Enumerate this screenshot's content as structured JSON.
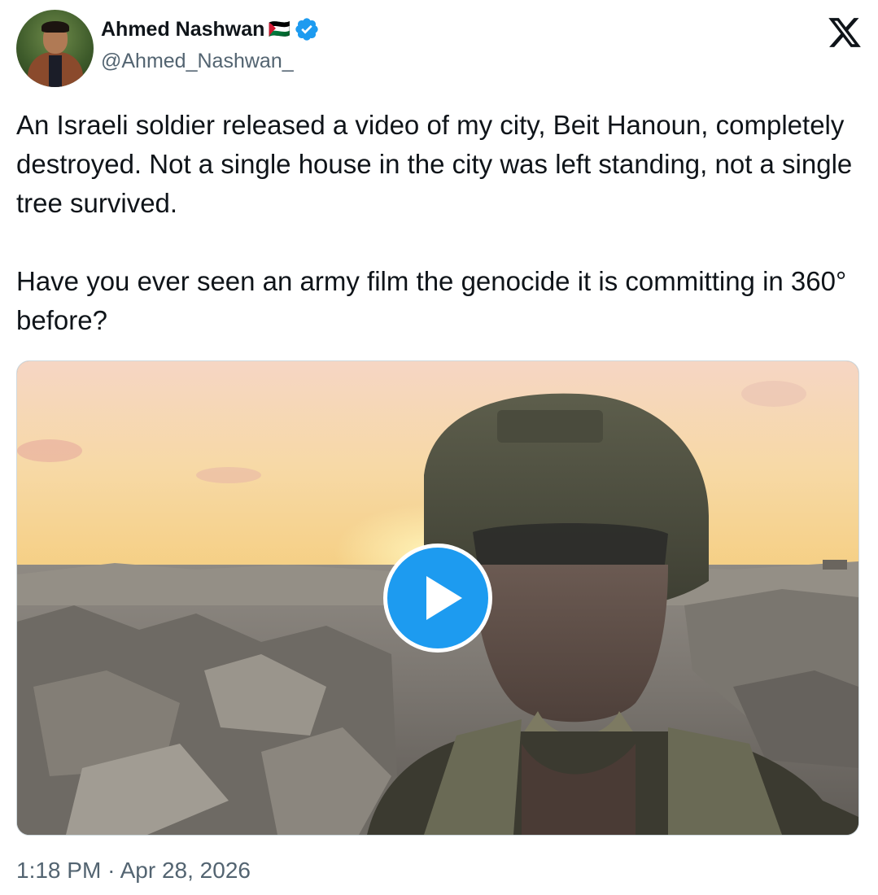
{
  "author": {
    "display_name": "Ahmed Nashwan",
    "name_suffix": "🇵🇸",
    "handle": "@Ahmed_Nashwan_",
    "verified": true,
    "verified_color": "#1d9bf0"
  },
  "brand": {
    "icon": "x-logo-icon"
  },
  "tweet": {
    "paragraph_1": "An Israeli soldier released a video of my city, Beit Hanoun, completely destroyed. Not a single house in the city was left standing, not a single tree survived.",
    "paragraph_2": "Have you ever seen an army film the genocide it is committing in 360° before?"
  },
  "media": {
    "type": "video",
    "play_icon": "play-icon",
    "accent_color": "#1d9bf0"
  },
  "meta": {
    "time": "1:18 PM",
    "separator": "·",
    "date": "Apr 28, 2026"
  }
}
